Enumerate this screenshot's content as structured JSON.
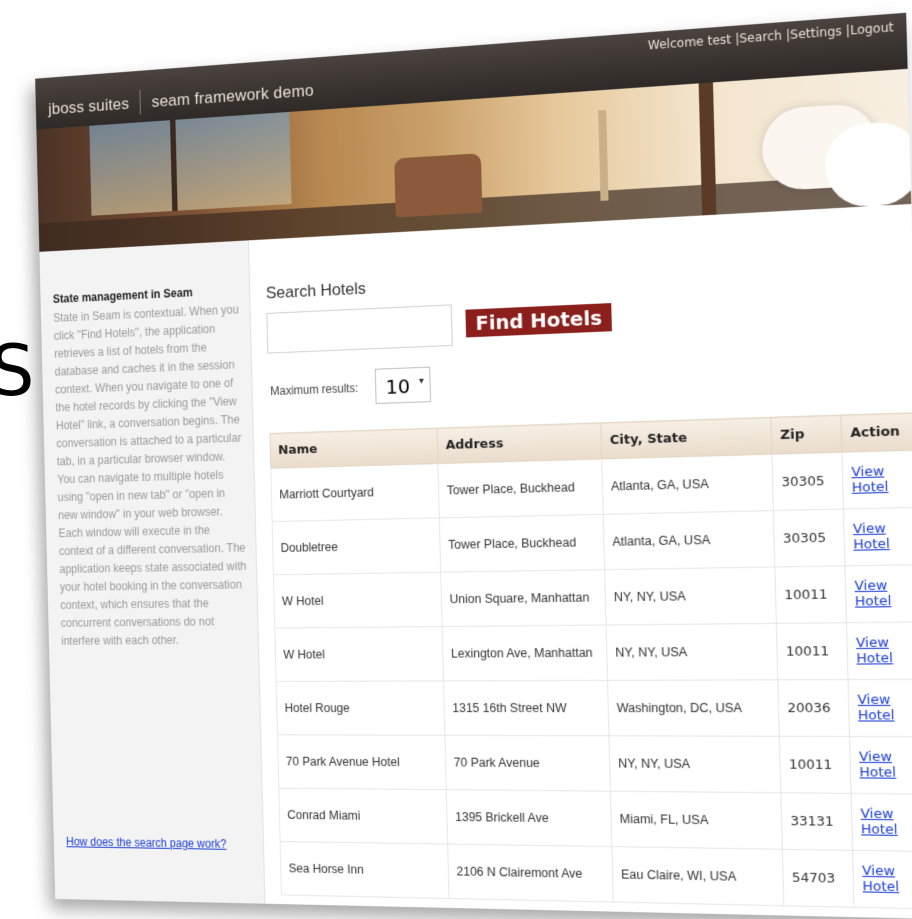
{
  "stray_glyph": "S",
  "header": {
    "brand_left": "jboss suites",
    "brand_right": "seam framework demo",
    "welcome": "Welcome test",
    "link_search": "|Search",
    "link_settings": "|Settings",
    "link_logout": "|Logout"
  },
  "sidebar": {
    "title": "State management in Seam",
    "body": "State in Seam is contextual. When you click \"Find Hotels\", the application retrieves a list of hotels from the database and caches it in the session context. When you navigate to one of the hotel records by clicking the \"View Hotel\" link, a conversation begins. The conversation is attached to a particular tab, in a particular browser window. You can navigate to multiple hotels using \"open in new tab\" or \"open in new window\" in your web browser. Each window will execute in the context of a different conversation. The application keeps state associated with your hotel booking in the conversation context, which ensures that the concurrent conversations do not interfere with each other.",
    "link": "How does the search page work?"
  },
  "search": {
    "heading": "Search Hotels",
    "query_value": "",
    "button_label": "Find Hotels",
    "max_label": "Maximum results:",
    "max_value": "10"
  },
  "table": {
    "headers": [
      "Name",
      "Address",
      "City, State",
      "Zip",
      "Action"
    ],
    "rows": [
      {
        "name": "Marriott Courtyard",
        "address": "Tower Place, Buckhead",
        "city": "Atlanta, GA, USA",
        "zip": "30305",
        "action": "View Hotel"
      },
      {
        "name": "Doubletree",
        "address": "Tower Place, Buckhead",
        "city": "Atlanta, GA, USA",
        "zip": "30305",
        "action": "View Hotel"
      },
      {
        "name": "W Hotel",
        "address": "Union Square, Manhattan",
        "city": "NY, NY, USA",
        "zip": "10011",
        "action": "View Hotel"
      },
      {
        "name": "W Hotel",
        "address": "Lexington Ave, Manhattan",
        "city": "NY, NY, USA",
        "zip": "10011",
        "action": "View Hotel"
      },
      {
        "name": "Hotel Rouge",
        "address": "1315 16th Street NW",
        "city": "Washington, DC, USA",
        "zip": "20036",
        "action": "View Hotel"
      },
      {
        "name": "70 Park Avenue Hotel",
        "address": "70 Park Avenue",
        "city": "NY, NY, USA",
        "zip": "10011",
        "action": "View Hotel"
      },
      {
        "name": "Conrad Miami",
        "address": "1395 Brickell Ave",
        "city": "Miami, FL, USA",
        "zip": "33131",
        "action": "View Hotel"
      },
      {
        "name": "Sea Horse Inn",
        "address": "2106 N Clairemont Ave",
        "city": "Eau Claire, WI, USA",
        "zip": "54703",
        "action": "View Hotel"
      }
    ]
  }
}
